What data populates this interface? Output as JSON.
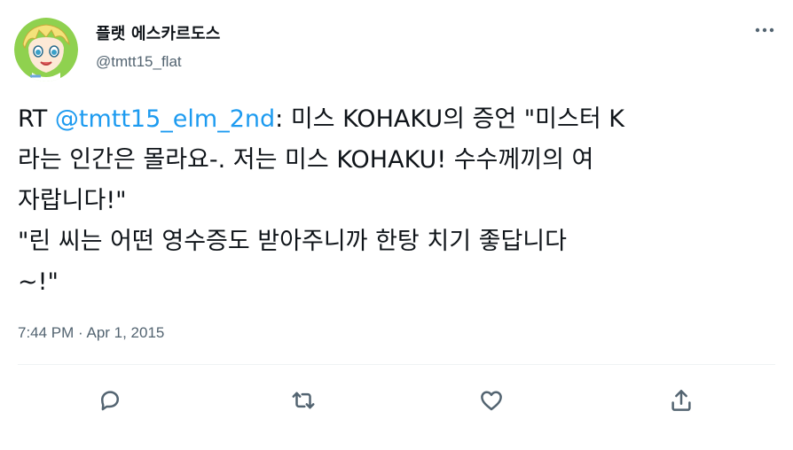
{
  "author": {
    "display_name": "플랫 에스카르도스",
    "handle": "@tmtt15_flat",
    "avatar": "anime-character-avatar"
  },
  "tweet": {
    "lines": [
      {
        "prefix": "RT ",
        "mention": "@tmtt15_elm_2nd",
        "text": ": 미스 KOHAKU의 증언 \"미스터 K"
      },
      {
        "text": "라는 인간은 몰라요-. 저는 미스 KOHAKU! 수수께끼의 여"
      },
      {
        "text": "자랍니다!\""
      },
      {
        "text": "\"린 씨는 어떤 영수증도 받아주니까 한탕 치기 좋답니다"
      },
      {
        "text": "~!\""
      }
    ],
    "timestamp": "7:44 PM · Apr 1, 2015"
  },
  "actions": {
    "icons": [
      "reply-icon",
      "retweet-icon",
      "like-icon",
      "share-icon"
    ]
  },
  "colors": {
    "text": "#0f1419",
    "secondary": "#536471",
    "link": "#1d9bf0",
    "divider": "#eff3f4"
  }
}
